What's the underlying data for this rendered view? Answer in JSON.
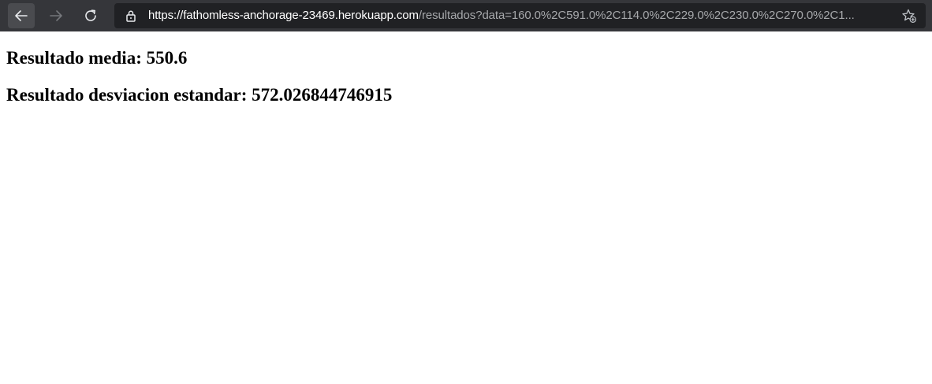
{
  "browser": {
    "url_host": "https://fathomless-anchorage-23469.herokuapp.com",
    "url_rest": "/resultados?data=160.0%2C591.0%2C114.0%2C229.0%2C230.0%2C270.0%2C1...",
    "icons": {
      "back": "arrow-left-icon",
      "forward": "arrow-right-icon",
      "reload": "reload-icon",
      "lock": "lock-icon",
      "favorite": "star-add-icon"
    }
  },
  "page": {
    "media_heading": "Resultado media: 550.6",
    "std_heading": "Resultado desviacion estandar: 572.026844746915"
  },
  "colors": {
    "toolbar_bg": "#35363a",
    "address_bg": "#202124",
    "url_host": "#ffffff",
    "url_rest": "#a6a8ab"
  }
}
